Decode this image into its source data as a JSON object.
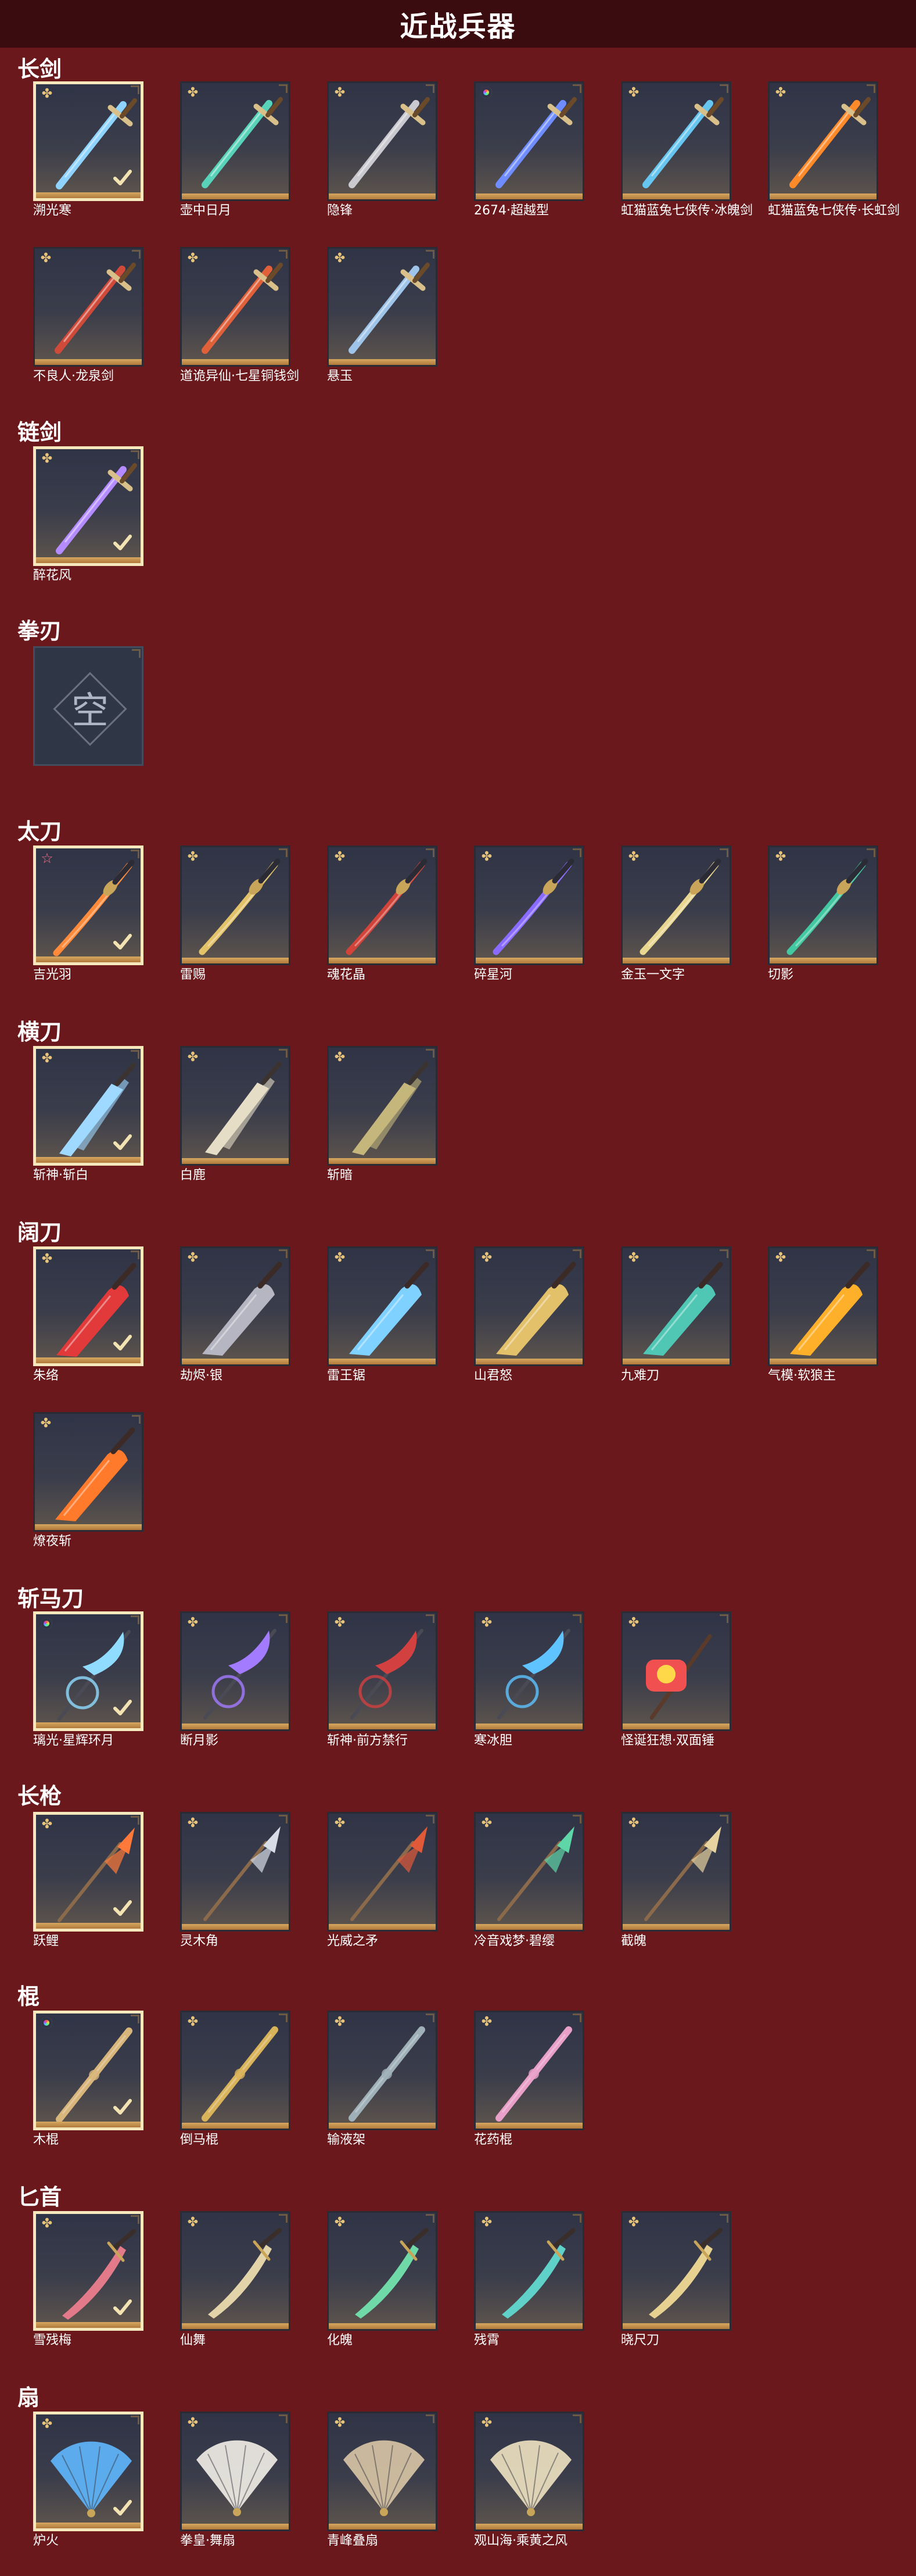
{
  "header": {
    "title": "近战兵器"
  },
  "categories": [
    {
      "name": "长剑",
      "items": [
        {
          "label": "溯光寒",
          "badge": "rune",
          "equipped": true,
          "color": "#8fd4ff",
          "shape": "sword"
        },
        {
          "label": "壶中日月",
          "badge": "rune",
          "equipped": false,
          "color": "#58d3b9",
          "shape": "sword"
        },
        {
          "label": "隐锋",
          "badge": "rune",
          "equipped": false,
          "color": "#c9c9cf",
          "shape": "sword"
        },
        {
          "label": "2674·超越型",
          "badge": "rainbow",
          "equipped": false,
          "color": "#6f8dff",
          "shape": "sword"
        },
        {
          "label": "虹猫蓝兔七侠传·冰魄剑",
          "badge": "rune",
          "equipped": false,
          "color": "#66c6f0",
          "shape": "sword"
        },
        {
          "label": "虹猫蓝兔七侠传·长虹剑",
          "badge": "rune",
          "equipped": false,
          "color": "#ff8a2a",
          "shape": "sword"
        },
        {
          "label": "不良人·龙泉剑",
          "badge": "rune",
          "equipped": false,
          "color": "#d04a3a",
          "shape": "sword"
        },
        {
          "label": "道诡异仙·七星铜钱剑",
          "badge": "rune",
          "equipped": false,
          "color": "#e0603a",
          "shape": "sword"
        },
        {
          "label": "悬玉",
          "badge": "rune",
          "equipped": false,
          "color": "#9fc4ea",
          "shape": "sword"
        }
      ]
    },
    {
      "name": "链剑",
      "items": [
        {
          "label": "醉花风",
          "badge": "rune",
          "equipped": true,
          "color": "#b48cff",
          "shape": "sword"
        }
      ]
    },
    {
      "name": "拳刃",
      "items": [
        {
          "label": "",
          "badge": "none",
          "equipped": false,
          "empty": true,
          "empty_char": "空",
          "color": "#aeb6c6",
          "shape": "none"
        }
      ]
    },
    {
      "name": "太刀",
      "items": [
        {
          "label": "吉光羽",
          "badge": "star",
          "equipped": true,
          "color": "#ff8a3a",
          "shape": "katana"
        },
        {
          "label": "雷赐",
          "badge": "rune",
          "equipped": false,
          "color": "#e3c36a",
          "shape": "katana"
        },
        {
          "label": "魂花晶",
          "badge": "rune",
          "equipped": false,
          "color": "#d2443a",
          "shape": "katana"
        },
        {
          "label": "碎星河",
          "badge": "rune",
          "equipped": false,
          "color": "#8a6bff",
          "shape": "katana"
        },
        {
          "label": "金玉一文字",
          "badge": "rune",
          "equipped": false,
          "color": "#e9d690",
          "shape": "katana"
        },
        {
          "label": "切影",
          "badge": "rune",
          "equipped": false,
          "color": "#43c9a1",
          "shape": "katana"
        }
      ]
    },
    {
      "name": "横刀",
      "items": [
        {
          "label": "斩神·斩白",
          "badge": "rune",
          "equipped": true,
          "color": "#9fd9ff",
          "shape": "blade"
        },
        {
          "label": "白鹿",
          "badge": "rune",
          "equipped": false,
          "color": "#e6ddc6",
          "shape": "blade"
        },
        {
          "label": "斩暗",
          "badge": "rune",
          "equipped": false,
          "color": "#c5b77b",
          "shape": "blade"
        }
      ]
    },
    {
      "name": "阔刀",
      "items": [
        {
          "label": "朱络",
          "badge": "rune",
          "equipped": true,
          "color": "#e23a3a",
          "shape": "broad"
        },
        {
          "label": "劫烬·银",
          "badge": "rune",
          "equipped": false,
          "color": "#b6b6c2",
          "shape": "broad"
        },
        {
          "label": "雷王锯",
          "badge": "rune",
          "equipped": false,
          "color": "#7fd1ff",
          "shape": "broad"
        },
        {
          "label": "山君怒",
          "badge": "rune",
          "equipped": false,
          "color": "#e3c06a",
          "shape": "broad"
        },
        {
          "label": "九难刀",
          "badge": "rune",
          "equipped": false,
          "color": "#4fc7b4",
          "shape": "broad"
        },
        {
          "label": "气模·软狼主",
          "badge": "rune",
          "equipped": false,
          "color": "#ffb02a",
          "shape": "broad"
        },
        {
          "label": "燎夜斩",
          "badge": "rune",
          "equipped": false,
          "color": "#ff7a2a",
          "shape": "broad"
        }
      ]
    },
    {
      "name": "斩马刀",
      "items": [
        {
          "label": "璃光·星辉环月",
          "badge": "rainbow",
          "equipped": true,
          "color": "#8fdcff",
          "shape": "halberd"
        },
        {
          "label": "断月影",
          "badge": "rune",
          "equipped": false,
          "color": "#a27bff",
          "shape": "halberd"
        },
        {
          "label": "斩神·前方禁行",
          "badge": "rune",
          "equipped": false,
          "color": "#d24040",
          "shape": "halberd"
        },
        {
          "label": "寒冰胆",
          "badge": "rune",
          "equipped": false,
          "color": "#5ec3ff",
          "shape": "halberd"
        },
        {
          "label": "怪诞狂想·双面锤",
          "badge": "rune",
          "equipped": false,
          "color": "#f05050",
          "shape": "hammer"
        }
      ]
    },
    {
      "name": "长枪",
      "items": [
        {
          "label": "跃鲤",
          "badge": "rune",
          "equipped": true,
          "color": "#ff7a3a",
          "shape": "spear"
        },
        {
          "label": "灵木角",
          "badge": "rune",
          "equipped": false,
          "color": "#d6dde6",
          "shape": "spear"
        },
        {
          "label": "光威之矛",
          "badge": "rune",
          "equipped": false,
          "color": "#e05a3a",
          "shape": "spear"
        },
        {
          "label": "冷音戏梦·碧缨",
          "badge": "rune",
          "equipped": false,
          "color": "#5fd6a8",
          "shape": "spear"
        },
        {
          "label": "截魄",
          "badge": "rune",
          "equipped": false,
          "color": "#e6d3a0",
          "shape": "spear"
        }
      ]
    },
    {
      "name": "棍",
      "items": [
        {
          "label": "木棍",
          "badge": "rainbow",
          "equipped": true,
          "color": "#d8b57a",
          "shape": "staff"
        },
        {
          "label": "倒马棍",
          "badge": "rune",
          "equipped": false,
          "color": "#d9b35a",
          "shape": "staff"
        },
        {
          "label": "输液架",
          "badge": "rune",
          "equipped": false,
          "color": "#9fb0b8",
          "shape": "staff"
        },
        {
          "label": "花药棍",
          "badge": "rune",
          "equipped": false,
          "color": "#e9a0c8",
          "shape": "staff"
        }
      ]
    },
    {
      "name": "匕首",
      "items": [
        {
          "label": "雪残梅",
          "badge": "rune",
          "equipped": true,
          "color": "#e27a8a",
          "shape": "dagger"
        },
        {
          "label": "仙舞",
          "badge": "rune",
          "equipped": false,
          "color": "#e3d3a8",
          "shape": "dagger"
        },
        {
          "label": "化魄",
          "badge": "rune",
          "equipped": false,
          "color": "#6fd9a8",
          "shape": "dagger"
        },
        {
          "label": "残霄",
          "badge": "rune",
          "equipped": false,
          "color": "#5fd1c9",
          "shape": "dagger"
        },
        {
          "label": "晓尺刀",
          "badge": "rune",
          "equipped": false,
          "color": "#e6d190",
          "shape": "dagger"
        }
      ]
    },
    {
      "name": "扇",
      "items": [
        {
          "label": "炉火",
          "badge": "rune",
          "equipped": true,
          "color": "#5fb8ff",
          "shape": "fan"
        },
        {
          "label": "拳皇·舞扇",
          "badge": "rune",
          "equipped": false,
          "color": "#f3efe8",
          "shape": "fan"
        },
        {
          "label": "青峰叠扇",
          "badge": "rune",
          "equipped": false,
          "color": "#d9c6a6",
          "shape": "fan"
        },
        {
          "label": "观山海·乘黄之风",
          "badge": "rune",
          "equipped": false,
          "color": "#f0e3c2",
          "shape": "fan"
        }
      ]
    }
  ]
}
